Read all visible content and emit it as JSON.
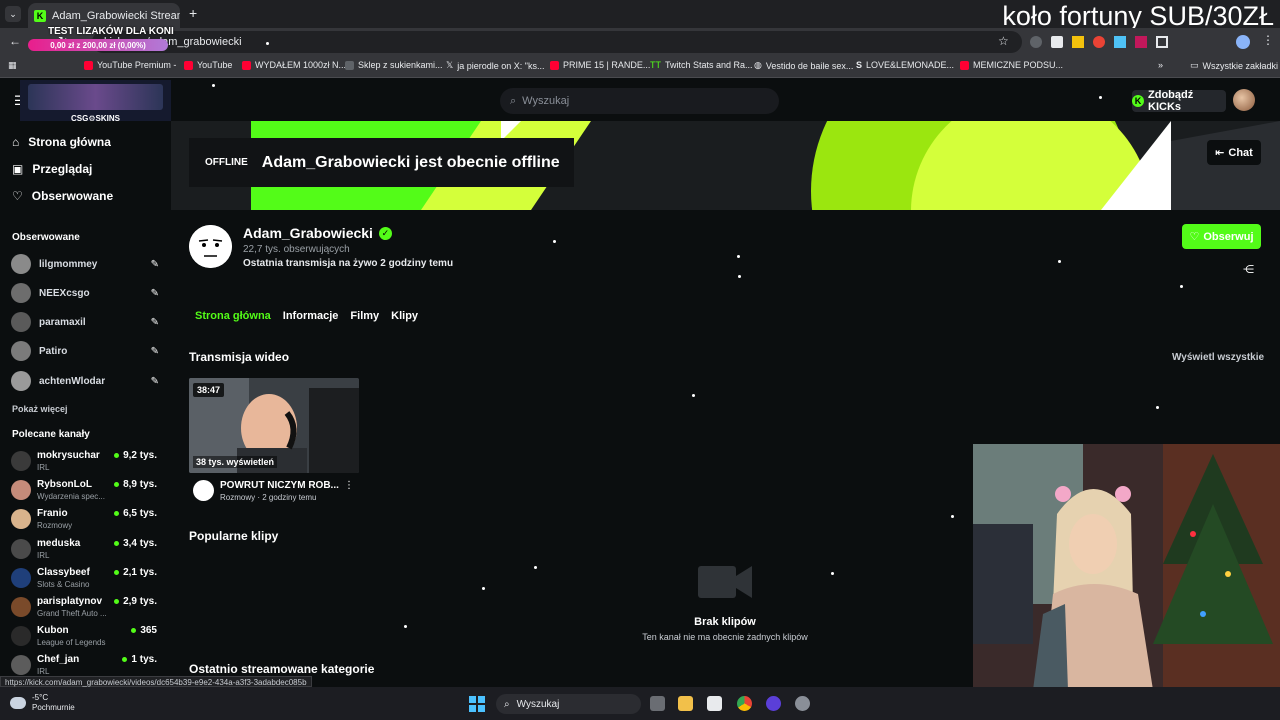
{
  "overlay": {
    "title": "koło fortuny SUB/30ZŁ",
    "promo_title": "TEST LIZAKÓW DLA KONI",
    "promo_progress": "0,00 zł z 200,00 zł (0,00%)",
    "promo_fraction": 0,
    "csg_label": "CSG⚙SKINS"
  },
  "browser": {
    "tab_title": "Adam_Grabowiecki Stream - W",
    "url": "kick.com/adam_grabowiecki",
    "bookmarks": [
      "YouTube Premium -",
      "YouTube",
      "WYDAŁEM 1000zł N...",
      "Sklep z sukienkami...",
      "ja pierodle on X: \"ks...",
      "PRIME 15 | RANDE...",
      "Twitch Stats and Ra...",
      "Vestido de baile sex...",
      "LOVE&LEMONADE...",
      "MEMICZNE PODSU..."
    ],
    "all_bookmarks": "Wszystkie zakładki",
    "status_url": "https://kick.com/adam_grabowiecki/videos/dc654b39-e9e2-434a-a3f3-3adabdec085b"
  },
  "header": {
    "search_placeholder": "Wyszukaj",
    "kicks_label": "Zdobądź KICKs"
  },
  "sidebar": {
    "nav": [
      "Strona główna",
      "Przeglądaj",
      "Obserwowane"
    ],
    "following_title": "Obserwowane",
    "following": [
      "lilgmommey",
      "NEEXcsgo",
      "paramaxil",
      "Patiro",
      "achtenWlodar"
    ],
    "show_more": "Pokaż więcej",
    "recommended_title": "Polecane kanały",
    "recommended": [
      {
        "name": "mokrysuchar",
        "category": "IRL",
        "viewers": "9,2 tys."
      },
      {
        "name": "RybsonLoL",
        "category": "Wydarzenia spec...",
        "viewers": "8,9 tys."
      },
      {
        "name": "Franio",
        "category": "Rozmowy",
        "viewers": "6,5 tys."
      },
      {
        "name": "meduska",
        "category": "IRL",
        "viewers": "3,4 tys."
      },
      {
        "name": "Classybeef",
        "category": "Slots & Casino",
        "viewers": "2,1 tys."
      },
      {
        "name": "parisplatynov",
        "category": "Grand Theft Auto ...",
        "viewers": "2,9 tys."
      },
      {
        "name": "Kubon",
        "category": "League of Legends",
        "viewers": "365"
      },
      {
        "name": "Chef_jan",
        "category": "IRL",
        "viewers": "1 tys."
      }
    ]
  },
  "banner": {
    "offline_tag": "OFFLINE",
    "offline_text": "Adam_Grabowiecki jest obecnie offline",
    "chat_label": "Chat"
  },
  "channel": {
    "name": "Adam_Grabowiecki",
    "followers": "22,7 tys. obserwujących",
    "last_stream": "Ostatnia transmisja na żywo 2 godziny temu",
    "follow_label": "Obserwuj",
    "tabs": [
      "Strona główna",
      "Informacje",
      "Filmy",
      "Klipy"
    ],
    "video_section": "Transmisja wideo",
    "see_all": "Wyświetl wszystkie",
    "video": {
      "duration": "38:47",
      "views": "38 tys. wyświetleń",
      "title": "POWRUT NICZYM ROB...",
      "meta": "Rozmowy · 2 godziny temu"
    },
    "clips_section": "Popularne klipy",
    "no_clips_title": "Brak klipów",
    "no_clips_desc": "Ten kanał nie ma obecnie żadnych klipów",
    "categories_section": "Ostatnio streamowane kategorie"
  },
  "taskbar": {
    "temperature": "-5°C",
    "weather": "Pochmurnie",
    "search": "Wyszukaj"
  },
  "colors": {
    "accent": "#53fc18",
    "background": "#0b0e0f"
  }
}
